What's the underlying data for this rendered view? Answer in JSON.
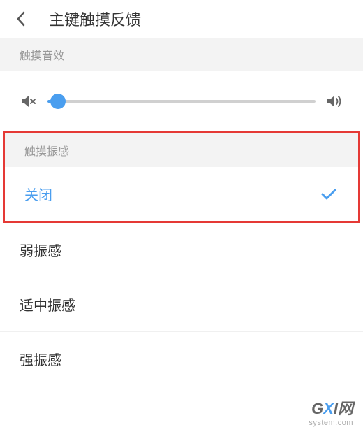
{
  "header": {
    "title": "主键触摸反馈"
  },
  "sections": {
    "sound": {
      "header": "触摸音效",
      "slider_value": 4
    },
    "vibration": {
      "header": "触摸振感",
      "options": [
        {
          "label": "关闭",
          "selected": true
        },
        {
          "label": "弱振感",
          "selected": false
        },
        {
          "label": "适中振感",
          "selected": false
        },
        {
          "label": "强振感",
          "selected": false
        }
      ]
    }
  },
  "watermark": {
    "main_prefix": "G",
    "main_accent": "X",
    "main_suffix": "I网",
    "sub": "system.com"
  }
}
